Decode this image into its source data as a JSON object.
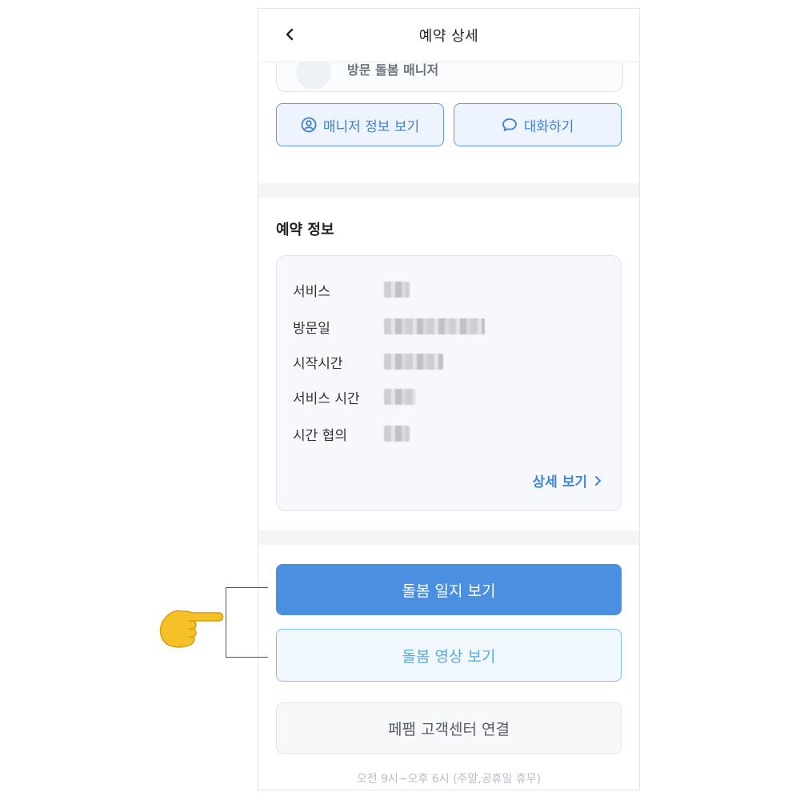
{
  "header": {
    "title": "예약 상세",
    "back_icon": "chevron-left-icon"
  },
  "manager": {
    "role_label": "방문 돌봄 매니저"
  },
  "actions": {
    "manager_info_label": "매니저 정보 보기",
    "manager_info_icon": "user-circle-icon",
    "chat_label": "대화하기",
    "chat_icon": "chat-bubble-icon"
  },
  "booking": {
    "section_title": "예약 정보",
    "rows": [
      {
        "label": "서비스"
      },
      {
        "label": "방문일"
      },
      {
        "label": "시작시간"
      },
      {
        "label": "서비스 시간"
      },
      {
        "label": "시간 협의"
      }
    ],
    "detail_link": "상세 보기"
  },
  "buttons": {
    "care_log": "돌봄 일지 보기",
    "care_video": "돌봄 영상 보기",
    "support": "페팸 고객센터 연결"
  },
  "support_hours": "오전 9시~오후 6시 (주말,공휴일 휴무)",
  "colors": {
    "accent": "#4a8fe0",
    "secondary": "#5aaad9",
    "outline": "#5d9be0"
  }
}
